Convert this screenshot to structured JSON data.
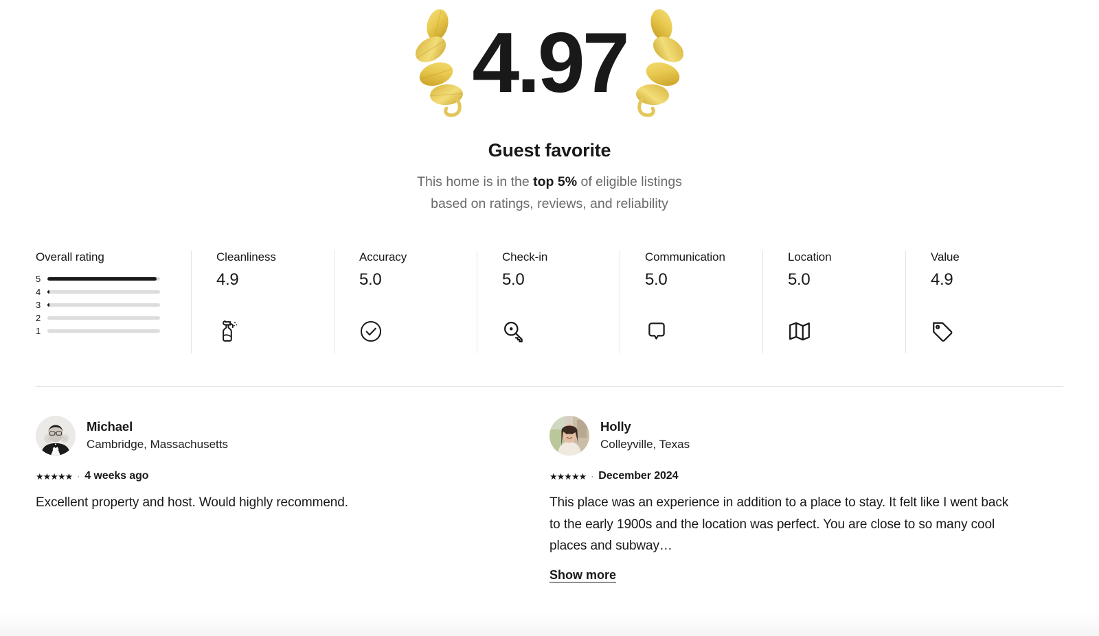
{
  "hero": {
    "score": "4.97",
    "badge_title": "Guest favorite",
    "subtitle_pre": "This home is in the ",
    "subtitle_bold": "top 5%",
    "subtitle_post": " of eligible listings",
    "subtitle_line2": "based on ratings, reviews, and reliability",
    "laurel_icon": "laurel-wreath-icon",
    "laurel_color": "#d4af37"
  },
  "rating_breakdown": {
    "label": "Overall rating",
    "rows": [
      {
        "stars": "5",
        "pct": 97
      },
      {
        "stars": "4",
        "pct": 2
      },
      {
        "stars": "3",
        "pct": 2
      },
      {
        "stars": "2",
        "pct": 0
      },
      {
        "stars": "1",
        "pct": 0
      }
    ]
  },
  "categories": [
    {
      "label": "Cleanliness",
      "value": "4.9",
      "icon": "spray-bottle-icon"
    },
    {
      "label": "Accuracy",
      "value": "5.0",
      "icon": "check-circle-icon"
    },
    {
      "label": "Check-in",
      "value": "5.0",
      "icon": "key-icon"
    },
    {
      "label": "Communication",
      "value": "5.0",
      "icon": "speech-bubble-icon"
    },
    {
      "label": "Location",
      "value": "5.0",
      "icon": "map-icon"
    },
    {
      "label": "Value",
      "value": "4.9",
      "icon": "price-tag-icon"
    }
  ],
  "reviews": [
    {
      "name": "Michael",
      "location": "Cambridge, Massachusetts",
      "stars": "★★★★★",
      "separator": "·",
      "date": "4 weeks ago",
      "body": "Excellent property and host. Would highly recommend.",
      "show_more": null,
      "avatar": "avatar-michael"
    },
    {
      "name": "Holly",
      "location": "Colleyville, Texas",
      "stars": "★★★★★",
      "separator": "·",
      "date": "December 2024",
      "body": "This place was an experience in addition to a place to stay. It felt like I went back to the early 1900s and the location was perfect. You are close to so many cool places and subway…",
      "show_more": "Show more",
      "avatar": "avatar-holly"
    }
  ],
  "colors": {
    "text": "#191919",
    "muted": "#6a6a6a",
    "track": "#dddddd",
    "divider": "#e3e3e3"
  }
}
